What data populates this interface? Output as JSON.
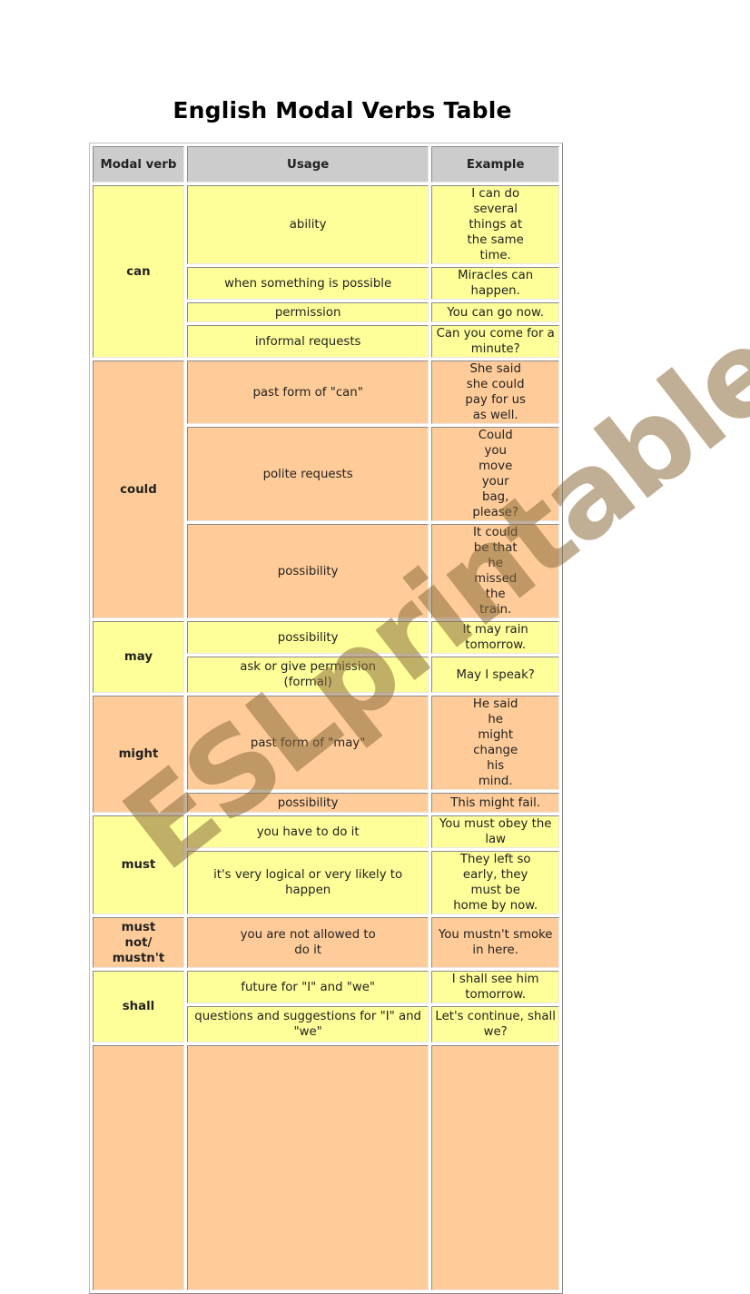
{
  "title": "English Modal Verbs Table",
  "table": {
    "headers": [
      "Modal verb",
      "Usage",
      "Example"
    ],
    "colors": {
      "header": "#cccccc",
      "yellow": "#ffff99",
      "orange": "#ffcc99"
    },
    "groups": [
      {
        "verb": "can",
        "color": "yellow",
        "rows": [
          {
            "usage": "ability",
            "example": "I can do several things at the same time."
          },
          {
            "usage": "when something is possible",
            "example": "Miracles can happen."
          },
          {
            "usage": "permission",
            "example": "You can go now."
          },
          {
            "usage": "informal requests",
            "example": "Can you come for a minute?"
          }
        ]
      },
      {
        "verb": "could",
        "color": "orange",
        "rows": [
          {
            "usage": "past form of \"can\"",
            "example": "She said she could pay for us as well."
          },
          {
            "usage": "polite requests",
            "example": "Could you move your bag, please?"
          },
          {
            "usage": "possibility",
            "example": "It could be that he missed the train."
          }
        ]
      },
      {
        "verb": "may",
        "color": "yellow",
        "rows": [
          {
            "usage": "possibility",
            "example": "It may rain tomorrow."
          },
          {
            "usage": "ask or give permission (formal)",
            "example": "May I speak?"
          }
        ]
      },
      {
        "verb": "might",
        "color": "orange",
        "rows": [
          {
            "usage": "past form of \"may\"",
            "example": "He said he might change his mind."
          },
          {
            "usage": "possibility",
            "example": "This might fail."
          }
        ]
      },
      {
        "verb": "must",
        "color": "yellow",
        "rows": [
          {
            "usage": "you have to do it",
            "example": "You must obey the law"
          },
          {
            "usage": "it's very logical or very likely to happen",
            "example": "They left so early, they must be home by now."
          }
        ]
      },
      {
        "verb": "must not/ mustn't",
        "color": "orange",
        "rows": [
          {
            "usage": "you are not allowed to do it",
            "example": "You mustn't smoke in here."
          }
        ]
      },
      {
        "verb": "shall",
        "color": "yellow",
        "rows": [
          {
            "usage": "future for \"I\" and \"we\"",
            "example": "I shall see him tomorrow."
          },
          {
            "usage": "questions and suggestions for \"I\" and \"we\"",
            "example": "Let's continue, shall we?"
          }
        ]
      }
    ]
  },
  "watermark": "ESLprintables.com"
}
